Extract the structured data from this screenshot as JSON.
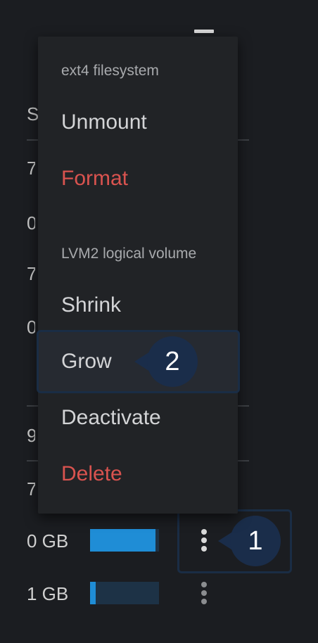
{
  "background": {
    "column_header": "S",
    "partial_cells": [
      "7",
      "0",
      "7",
      "0",
      "9",
      "7"
    ],
    "rows": [
      {
        "size": "0 GB",
        "usage": 0.95
      },
      {
        "size": "1 GB",
        "usage": 0.08
      }
    ]
  },
  "menu": {
    "groups": [
      {
        "label": "ext4 filesystem",
        "items": [
          {
            "label": "Unmount",
            "danger": false
          },
          {
            "label": "Format",
            "danger": true
          }
        ]
      },
      {
        "label": "LVM2 logical volume",
        "items": [
          {
            "label": "Shrink",
            "danger": false
          },
          {
            "label": "Grow",
            "danger": false
          },
          {
            "label": "Deactivate",
            "danger": false
          },
          {
            "label": "Delete",
            "danger": true
          }
        ]
      }
    ]
  },
  "callouts": {
    "step1": "1",
    "step2": "2"
  },
  "colors": {
    "background": "#1b1d21",
    "menu_background": "#212326",
    "danger": "#d9534f",
    "usage_fill": "#1f8dd6",
    "callout": "#1a2d4a"
  },
  "icons": {
    "row_actions": "kebab-vertical-icon"
  }
}
